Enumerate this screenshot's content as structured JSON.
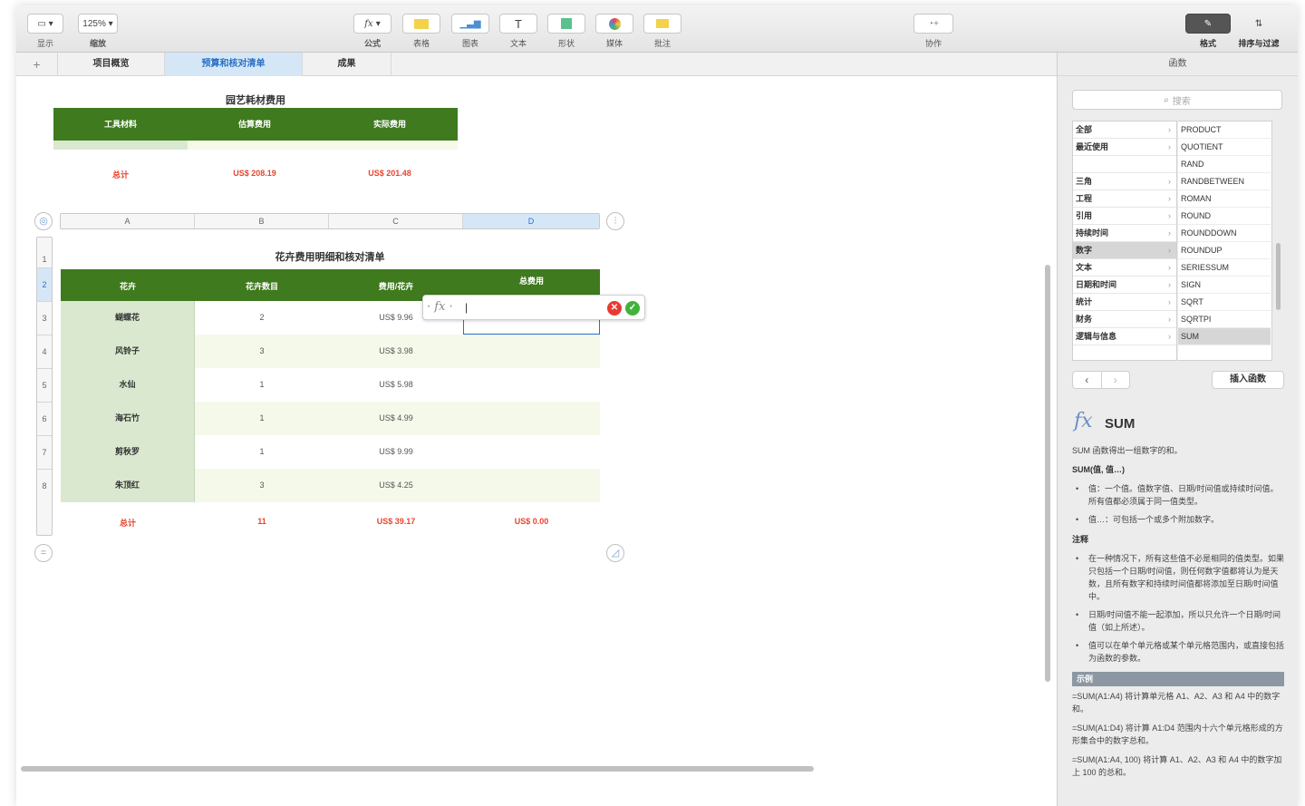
{
  "toolbar": {
    "view_label": "显示",
    "zoom_value": "125%",
    "zoom_label": "缩放",
    "formula_label": "公式",
    "table_label": "表格",
    "chart_label": "图表",
    "text_label": "文本",
    "shape_label": "形状",
    "media_label": "媒体",
    "comment_label": "批注",
    "collab_label": "协作",
    "format_label": "格式",
    "sort_label": "排序与过滤"
  },
  "tabs": [
    "项目概览",
    "预算和核对清单",
    "成果"
  ],
  "table1": {
    "title": "园艺耗材费用",
    "headers": [
      "工具材料",
      "估算费用",
      "实际费用"
    ],
    "totals": [
      "总计",
      "US$ 208.19",
      "US$ 201.48"
    ]
  },
  "column_letters": [
    "A",
    "B",
    "C",
    "D"
  ],
  "row_numbers": [
    "1",
    "2",
    "3",
    "4",
    "5",
    "6",
    "7",
    "8"
  ],
  "table2": {
    "title": "花卉费用明细和核对清单",
    "headers": [
      "花卉",
      "花卉数目",
      "费用/花卉",
      "总费用"
    ],
    "rows": [
      {
        "name": "蝴蝶花",
        "count": "2",
        "price": "US$ 9.96"
      },
      {
        "name": "风铃子",
        "count": "3",
        "price": "US$ 3.98"
      },
      {
        "name": "水仙",
        "count": "1",
        "price": "US$ 5.98"
      },
      {
        "name": "海石竹",
        "count": "1",
        "price": "US$ 4.99"
      },
      {
        "name": "剪秋罗",
        "count": "1",
        "price": "US$ 9.99"
      },
      {
        "name": "朱顶红",
        "count": "3",
        "price": "US$ 4.25"
      }
    ],
    "totals": [
      "总计",
      "11",
      "US$ 39.17",
      "US$ 0.00"
    ]
  },
  "formula_editor": {
    "fx_label": "fx",
    "content": "|"
  },
  "sidebar": {
    "title": "函数",
    "search_placeholder": "搜索",
    "categories": [
      {
        "label": "全部",
        "arrow": "›"
      },
      {
        "label": "最近使用",
        "arrow": "›"
      },
      {
        "label": "",
        "arrow": ""
      },
      {
        "label": "三角",
        "arrow": "›"
      },
      {
        "label": "工程",
        "arrow": "›"
      },
      {
        "label": "引用",
        "arrow": "›"
      },
      {
        "label": "持续时间",
        "arrow": "›"
      },
      {
        "label": "数字",
        "arrow": "›"
      },
      {
        "label": "文本",
        "arrow": "›"
      },
      {
        "label": "日期和时间",
        "arrow": "›"
      },
      {
        "label": "统计",
        "arrow": "›"
      },
      {
        "label": "财务",
        "arrow": "›"
      },
      {
        "label": "逻辑与信息",
        "arrow": "›"
      }
    ],
    "functions": [
      "PRODUCT",
      "QUOTIENT",
      "RAND",
      "RANDBETWEEN",
      "ROMAN",
      "ROUND",
      "ROUNDDOWN",
      "ROUNDUP",
      "SERIESSUM",
      "SIGN",
      "SQRT",
      "SQRTPI",
      "SUM"
    ],
    "insert_label": "插入函数",
    "func_name": "SUM",
    "func_desc": "SUM 函数得出一组数字的和。",
    "syntax": "SUM(值, 值…)",
    "args": [
      "值：一个值。值数字值、日期/时间值或持续时间值。所有值都必须属于同一值类型。",
      "值…：可包括一个或多个附加数字。"
    ],
    "notes_heading": "注释",
    "notes": [
      "在一种情况下，所有这些值不必是相同的值类型。如果只包括一个日期/时间值，则任何数字值都将认为是天数，且所有数字和持续时间值都将添加至日期/时间值中。",
      "日期/时间值不能一起添加，所以只允许一个日期/时间值（如上所述）。",
      "值可以在单个单元格或某个单元格范围内，或直接包括为函数的参数。"
    ],
    "examples_heading": "示例",
    "examples": [
      "=SUM(A1:A4) 将计算单元格 A1、A2、A3 和 A4 中的数字和。",
      "=SUM(A1:D4) 将计算 A1:D4 范围内十六个单元格形成的方形集合中的数字总和。",
      "=SUM(A1:A4, 100) 将计算 A1、A2、A3 和 A4 中的数字加上 100 的总和。"
    ]
  },
  "colors": {
    "table_header": "#3f7a1e",
    "totals": "#e8442e",
    "selection": "#2a6fc4"
  }
}
